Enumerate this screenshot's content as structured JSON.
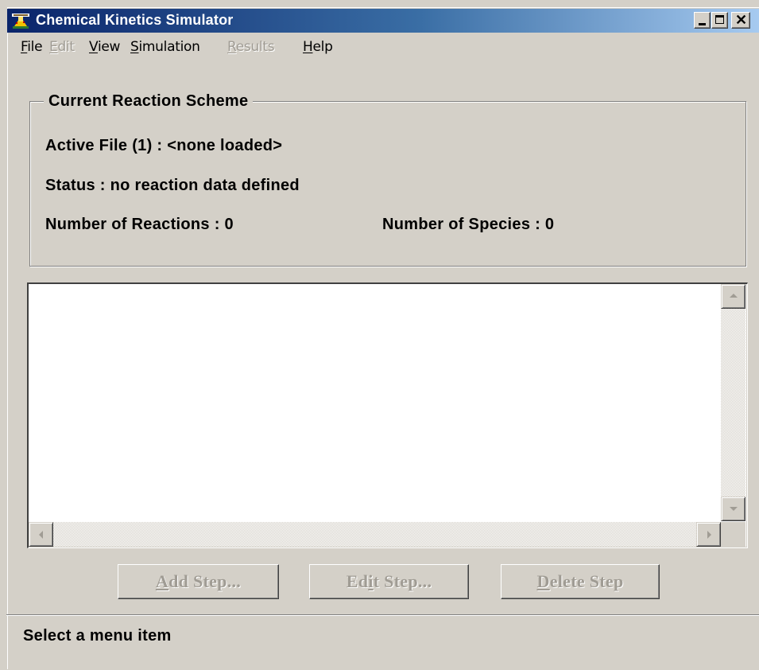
{
  "window": {
    "title": "Chemical Kinetics Simulator",
    "icon": "app-icon"
  },
  "menu": {
    "items": [
      {
        "label": "File",
        "mnemonic": "F",
        "rest": "ile",
        "enabled": true
      },
      {
        "label": "Edit",
        "mnemonic": "E",
        "rest": "dit",
        "enabled": false
      },
      {
        "label": "View",
        "mnemonic": "V",
        "rest": "iew",
        "enabled": true
      },
      {
        "label": "Simulation",
        "mnemonic": "S",
        "rest": "imulation",
        "enabled": true
      },
      {
        "label": "Results",
        "mnemonic": "R",
        "rest": "esults",
        "enabled": false
      },
      {
        "label": "Help",
        "mnemonic": "H",
        "rest": "elp",
        "enabled": true
      }
    ]
  },
  "scheme": {
    "legend": "Current Reaction Scheme",
    "active_file": "Active File (1) : <none loaded>",
    "status": "Status : no reaction data defined",
    "num_reactions": "Number of Reactions : 0",
    "num_species": "Number of Species : 0"
  },
  "buttons": {
    "add": {
      "pre": "",
      "mnemonic": "A",
      "post": "dd Step...",
      "enabled": false
    },
    "edit": {
      "pre": "Ed",
      "mnemonic": "i",
      "post": "t Step...",
      "enabled": false
    },
    "delete": {
      "pre": "",
      "mnemonic": "D",
      "post": "elete Step",
      "enabled": false
    }
  },
  "statusbar": {
    "text": "Select a menu item"
  },
  "colors": {
    "title_gradient_start": "#0a246a",
    "title_gradient_end": "#a6caf0",
    "face": "#d4d0c8",
    "disabled_text": "#a09c94"
  }
}
